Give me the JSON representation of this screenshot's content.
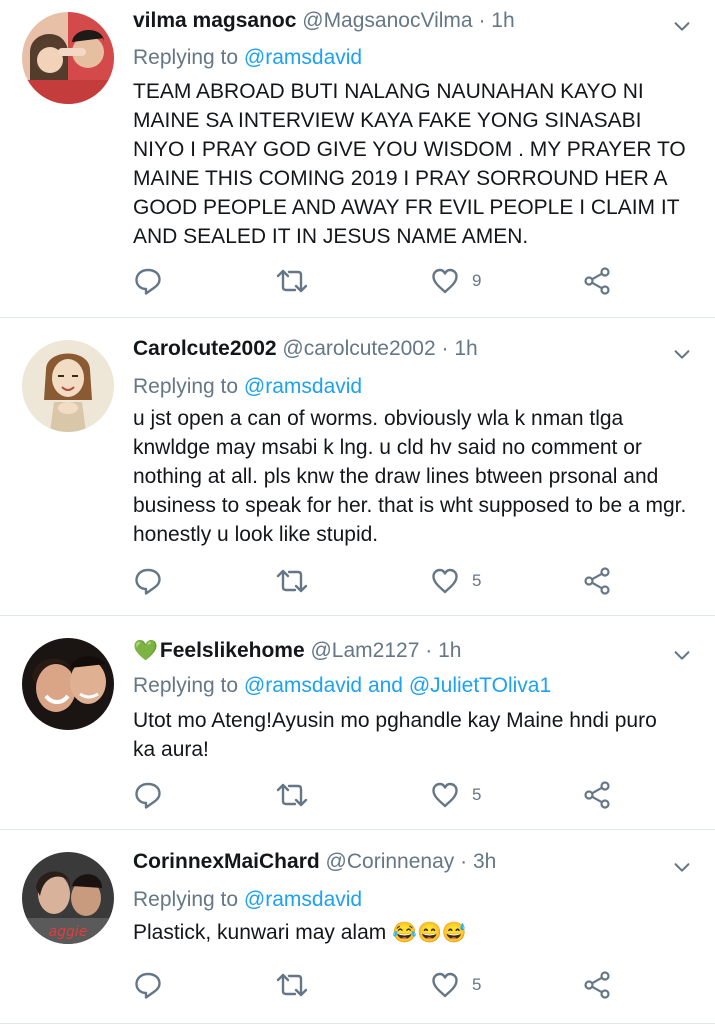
{
  "reply_prefix": "Replying to",
  "tweets": [
    {
      "name": "vilma magsanoc",
      "handle": "@MagsanocVilma",
      "dot": "·",
      "time": "1h",
      "reply_to": "@ramsdavid",
      "reply_and": "",
      "reply_to2": "",
      "text": "TEAM ABROAD BUTI NALANG NAUNAHAN KAYO NI MAINE SA INTERVIEW KAYA FAKE YONG SINASABI NIYO I PRAY GOD GIVE YOU WISDOM . MY PRAYER TO MAINE THIS COMING 2019 I PRAY SORROUND HER A GOOD PEOPLE AND AWAY FR EVIL PEOPLE I CLAIM IT AND SEALED IT IN JESUS NAME AMEN.",
      "likes": "9"
    },
    {
      "name": "Carolcute2002",
      "handle": "@carolcute2002",
      "dot": "·",
      "time": "1h",
      "reply_to": "@ramsdavid",
      "reply_and": "",
      "reply_to2": "",
      "text": "u jst open a can of worms. obviously wla k nman tlga knwldge may msabi k lng. u cld hv said no comment or nothing at all. pls knw the draw lines btween prsonal and business to speak for her. that is wht supposed to be a mgr. honestly u look like stupid.",
      "likes": "5"
    },
    {
      "name_prefix": "💚",
      "name": "Feelslikehome",
      "handle": "@Lam2127",
      "dot": "·",
      "time": "1h",
      "reply_to": "@ramsdavid",
      "reply_and": "and",
      "reply_to2": "@JulietTOliva1",
      "text": "Utot mo Ateng!Ayusin mo pghandle kay Maine hndi puro ka aura!",
      "likes": "5"
    },
    {
      "name": "CorinnexMaiChard",
      "handle": "@Corinnenay",
      "dot": "·",
      "time": "3h",
      "reply_to": "@ramsdavid",
      "reply_and": "",
      "reply_to2": "",
      "text": "Plastick, kunwari may alam",
      "emoji": "😂😄😅",
      "likes": "5"
    }
  ],
  "icons": [
    "chevron-down-icon",
    "reply-icon",
    "retweet-icon",
    "like-icon",
    "share-icon"
  ],
  "colors": {
    "link": "#1da1f2",
    "muted": "#657786",
    "text": "#14171a",
    "divider": "#e1e8ed"
  }
}
